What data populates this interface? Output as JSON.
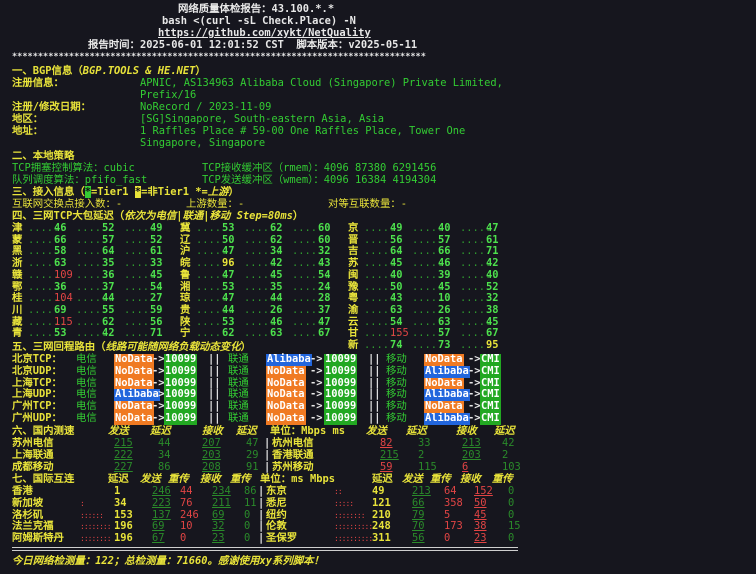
{
  "header": {
    "title": "网络质量体检报告：43.100.*.*",
    "cmd": "bash <(curl -sL Check.Place) -N",
    "url": "https://github.com/xykt/NetQuality",
    "report_time_label": "报告时间：",
    "report_time": "2025-06-01 12:01:52 CST",
    "version_label": "脚本版本：",
    "version": "v2025-05-11",
    "rule": "********************************************************************************"
  },
  "bgp": {
    "heading": "一、BGP信息（",
    "heading_src": "BGP.TOOLS & HE.NET",
    "heading_end": "）",
    "reg_label": "注册信息：",
    "reg_value1": "APNIC, AS134963 Alibaba Cloud (Singapore) Private Limited,",
    "reg_value2": "Prefix/16",
    "date_label": "注册/修改日期：",
    "date_value": "NoRecord / 2023-11-09",
    "region_label": "地区：",
    "region_value": "[SG]Singapore, South-eastern Asia, Asia",
    "addr_label": "地址：",
    "addr_value1": "1 Raffles Place # 59-00 One Raffles Place, Tower One",
    "addr_value2": "Singapore, Singapore"
  },
  "local": {
    "heading": "二、本地策略",
    "tcp_label": "TCP拥塞控制算法：",
    "tcp_value": "cubic",
    "rmem_label": "TCP接收缓冲区（rmem）：",
    "rmem_value": "4096 87380 6291456",
    "queue_label": "队列调度算法：",
    "queue_value": "pfifo_fast",
    "wmem_label": "TCP发送缓冲区（wmem）：",
    "wmem_value": "4096 16384 4194304"
  },
  "access": {
    "heading": "三、接入信息（",
    "tier1_mark": "*",
    "tier1_text": "=Tier1 ",
    "non_tier1_mark": "*",
    "non_tier1_text": "=非Tier1 ",
    "upstream_text": "*=上游",
    "heading_end": "）",
    "ix_label": "互联网交换点接入数：",
    "ix_value": "-",
    "up_label": "上游数量：",
    "up_value": "-",
    "peer_label": "对等互联数量：",
    "peer_value": "-"
  },
  "latency": {
    "heading": "四、三网TCP大包延迟（",
    "heading_note": "依次为电信|联通|移动 Step=80ms",
    "heading_end": "）",
    "rows": [
      [
        [
          "津",
          "46",
          "52",
          "49"
        ],
        [
          "冀",
          "53",
          "62",
          "60"
        ],
        [
          "京",
          "49",
          "40",
          "47"
        ]
      ],
      [
        [
          "蒙",
          "66",
          "57",
          "52"
        ],
        [
          "辽",
          "50",
          "62",
          "60"
        ],
        [
          "晋",
          "56",
          "57",
          "61"
        ]
      ],
      [
        [
          "黑",
          "58",
          "64",
          "61"
        ],
        [
          "沪",
          "47",
          "34",
          "32"
        ],
        [
          "吉",
          "64",
          "66",
          "71"
        ]
      ],
      [
        [
          "浙",
          "63",
          "35",
          "33"
        ],
        [
          "皖",
          "96",
          "42",
          "43"
        ],
        [
          "苏",
          "45",
          "46",
          "42"
        ]
      ],
      [
        [
          "赣",
          "109",
          "36",
          "45"
        ],
        [
          "鲁",
          "47",
          "45",
          "54"
        ],
        [
          "闽",
          "40",
          "39",
          "40"
        ]
      ],
      [
        [
          "鄂",
          "36",
          "37",
          "54"
        ],
        [
          "湘",
          "53",
          "35",
          "24"
        ],
        [
          "豫",
          "50",
          "45",
          "52"
        ]
      ],
      [
        [
          "桂",
          "104",
          "44",
          "27"
        ],
        [
          "琼",
          "47",
          "44",
          "28"
        ],
        [
          "粤",
          "43",
          "10",
          "32"
        ]
      ],
      [
        [
          "川",
          "69",
          "55",
          "59"
        ],
        [
          "贵",
          "44",
          "26",
          "37"
        ],
        [
          "渝",
          "63",
          "26",
          "38"
        ]
      ],
      [
        [
          "藏",
          "115",
          "62",
          "56"
        ],
        [
          "陕",
          "53",
          "46",
          "47"
        ],
        [
          "云",
          "54",
          "63",
          "45"
        ]
      ],
      [
        [
          "青",
          "53",
          "42",
          "71"
        ],
        [
          "宁",
          "62",
          "63",
          "67"
        ],
        [
          "甘",
          "155",
          "57",
          "67"
        ]
      ],
      [
        [
          "",
          "",
          "",
          ""
        ],
        [
          "",
          "",
          "",
          ""
        ],
        [
          "新",
          "74",
          "73",
          "95"
        ]
      ]
    ]
  },
  "routes": {
    "heading": "五、三网回程路由（",
    "heading_note": "线路可能随网络负载动态变化",
    "heading_end": "）",
    "rows": [
      {
        "name": "北京TCP：",
        "ct": "电信",
        "ct_tag": "NoData",
        "ct_as": "10099",
        "cu": "联通",
        "cu_tag": "Alibaba",
        "cu_as": "10099",
        "cm": "移动",
        "cm_tag": "NoData",
        "cm_as": "CMI"
      },
      {
        "name": "北京UDP：",
        "ct": "电信",
        "ct_tag": "NoData",
        "ct_as": "10099",
        "cu": "联通",
        "cu_tag": "NoData",
        "cu_as": "10099",
        "cm": "移动",
        "cm_tag": "Alibaba",
        "cm_as": "CMI"
      },
      {
        "name": "上海TCP：",
        "ct": "电信",
        "ct_tag": "NoData",
        "ct_as": "10099",
        "cu": "联通",
        "cu_tag": "NoData",
        "cu_as": "10099",
        "cm": "移动",
        "cm_tag": "NoData",
        "cm_as": "CMI"
      },
      {
        "name": "上海UDP：",
        "ct": "电信",
        "ct_tag": "Alibaba",
        "ct_as": "10099",
        "cu": "联通",
        "cu_tag": "NoData",
        "cu_as": "10099",
        "cm": "移动",
        "cm_tag": "Alibaba",
        "cm_as": "CMI"
      },
      {
        "name": "广州TCP：",
        "ct": "电信",
        "ct_tag": "NoData",
        "ct_as": "10099",
        "cu": "联通",
        "cu_tag": "NoData",
        "cu_as": "10099",
        "cm": "移动",
        "cm_tag": "NoData",
        "cm_as": "CMI"
      },
      {
        "name": "广州UDP：",
        "ct": "电信",
        "ct_tag": "NoData",
        "ct_as": "10099",
        "cu": "联通",
        "cu_tag": "NoData",
        "cu_as": "10099",
        "cm": "移动",
        "cm_tag": "Alibaba",
        "cm_as": "CMI"
      }
    ]
  },
  "domestic": {
    "heading": "六、国内测速",
    "col_send": "发送",
    "col_lat": "延迟",
    "col_recv": "接收",
    "unit": "单位：Mbps ms",
    "rows": [
      {
        "name": "苏州电信",
        "send": "215",
        "lat1": "44",
        "recv": "207",
        "lat2": "47",
        "name2": "杭州电信",
        "send2": "82",
        "lat3": "33",
        "recv2": "213",
        "lat4": "42"
      },
      {
        "name": "上海联通",
        "send": "222",
        "lat1": "34",
        "recv": "203",
        "lat2": "29",
        "name2": "香港联通",
        "send2": "215",
        "lat3": "2",
        "recv2": "203",
        "lat4": "2"
      },
      {
        "name": "成都移动",
        "send": "227",
        "lat1": "86",
        "recv": "208",
        "lat2": "91",
        "name2": "苏州移动",
        "send2": "59",
        "lat3": "115",
        "recv2": "6",
        "lat4": "103"
      }
    ]
  },
  "intl": {
    "heading": "七、国际互连",
    "col_lat": "延迟",
    "col_send": "发送",
    "col_retr": "重传",
    "col_recv": "接收",
    "col_retr2": "重传",
    "unit": "单位：ms Mbps",
    "rows": [
      {
        "name": "香港",
        "lat": "1",
        "send": "246",
        "r1": "44",
        "recv": "234",
        "r2": "86",
        "name2": "东京",
        "lat2": "49",
        "send2": "213",
        "r3": "64",
        "recv2": "152",
        "r4": "0"
      },
      {
        "name": "新加坡",
        "lat": "34",
        "send": "223",
        "r1": "76",
        "recv": "211",
        "r2": "11",
        "name2": "悉尼",
        "lat2": "121",
        "send2": "66",
        "r3": "358",
        "recv2": "50",
        "r4": "0"
      },
      {
        "name": "洛杉矶",
        "lat": "153",
        "send": "137",
        "r1": "246",
        "recv": "69",
        "r2": "0",
        "name2": "纽约",
        "lat2": "210",
        "send2": "79",
        "r3": "5",
        "recv2": "45",
        "r4": "0"
      },
      {
        "name": "法兰克福",
        "lat": "196",
        "send": "69",
        "r1": "10",
        "recv": "32",
        "r2": "0",
        "name2": "伦敦",
        "lat2": "248",
        "send2": "70",
        "r3": "173",
        "recv2": "38",
        "r4": "15"
      },
      {
        "name": "阿姆斯特丹",
        "lat": "196",
        "send": "67",
        "r1": "0",
        "recv": "23",
        "r2": "0",
        "name2": "圣保罗",
        "lat2": "311",
        "send2": "56",
        "r3": "0",
        "recv2": "23",
        "r4": "0"
      }
    ]
  },
  "footer": {
    "text": "今日网络检测量：122；总检测量：71660。感谢使用xy系列脚本！"
  }
}
